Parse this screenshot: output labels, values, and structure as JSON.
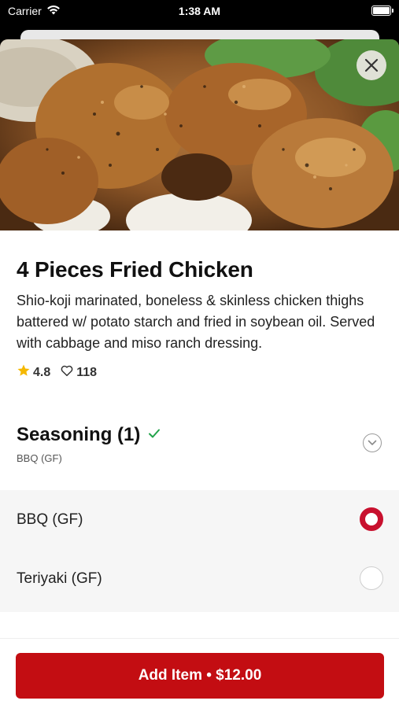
{
  "status_bar": {
    "carrier": "Carrier",
    "time": "1:38 AM"
  },
  "item": {
    "title": "4 Pieces Fried Chicken",
    "description": "Shio-koji marinated, boneless & skinless chicken thighs battered w/ potato starch and fried in soybean oil. Served with cabbage and miso ranch dressing.",
    "rating": "4.8",
    "likes": "118"
  },
  "seasoning": {
    "title": "Seasoning (1)",
    "selected_summary": "BBQ (GF)",
    "options": [
      {
        "label": "BBQ (GF)",
        "selected": true
      },
      {
        "label": "Teriyaki (GF)",
        "selected": false
      }
    ]
  },
  "footer": {
    "add_button_label": "Add Item • $12.00"
  },
  "colors": {
    "accent": "#c30d12",
    "check": "#22a34a",
    "star": "#f5b800"
  },
  "icons": [
    "wifi-icon",
    "battery-icon",
    "close-icon",
    "star-icon",
    "heart-icon",
    "checkmark-icon",
    "chevron-down-icon"
  ]
}
